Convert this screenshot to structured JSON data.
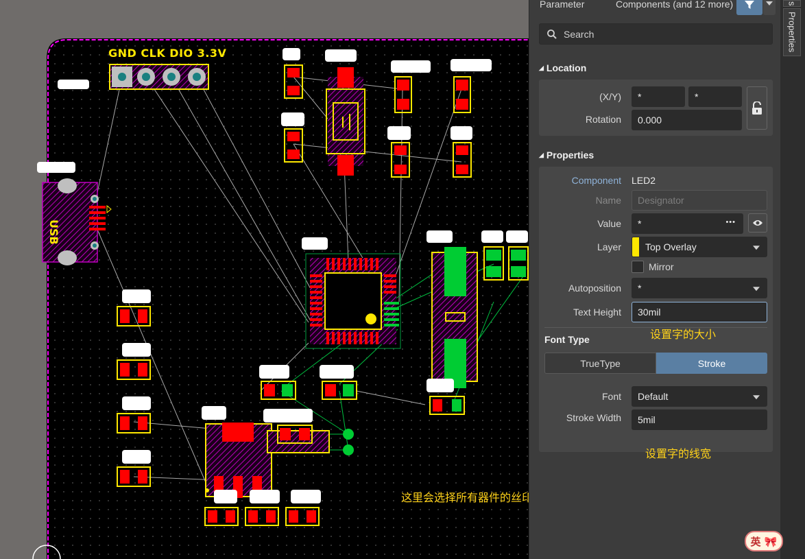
{
  "pcb": {
    "header_label": "GND CLK DIO 3.3V",
    "usb_label": "USB",
    "annotations": {
      "text_size": "设置字的大小",
      "stroke_width": "设置字的线宽",
      "select_all": "这里会选择所有器件的丝印"
    },
    "colors": {
      "board": "#000000",
      "outline": "#ff00ff",
      "pad": "#ff0000",
      "silk": "#ffe800",
      "bottom_pad": "#00cc33",
      "ratsnest": "#c8c8c8"
    }
  },
  "panel": {
    "header": {
      "left": "Parameter",
      "right": "Components (and 12 more)"
    },
    "search": {
      "placeholder": "Search"
    },
    "location": {
      "title": "Location",
      "xy_label": "(X/Y)",
      "x_value": "*",
      "y_value": "*",
      "rotation_label": "Rotation",
      "rotation_value": "0.000"
    },
    "properties": {
      "title": "Properties",
      "component_label": "Component",
      "component_value": "LED2",
      "name_label": "Name",
      "name_placeholder": "Designator",
      "value_label": "Value",
      "value_value": "*",
      "value_more": "•••",
      "layer_label": "Layer",
      "layer_value": "Top Overlay",
      "mirror_label": "Mirror",
      "autoposition_label": "Autoposition",
      "autoposition_value": "*",
      "text_height_label": "Text Height",
      "text_height_value": "30mil"
    },
    "font_type": {
      "title": "Font Type",
      "truetype_label": "TrueType",
      "stroke_label": "Stroke",
      "selected": "Stroke",
      "font_label": "Font",
      "font_value": "Default",
      "stroke_width_label": "Stroke Width",
      "stroke_width_value": "5mil"
    },
    "colors": {
      "accent": "#5a7fa3",
      "layer_swatch": "#ffe800"
    }
  },
  "side_tabs": {
    "tab1": "s",
    "tab2": "Properties"
  },
  "watermark": {
    "text": "英 🎀"
  }
}
